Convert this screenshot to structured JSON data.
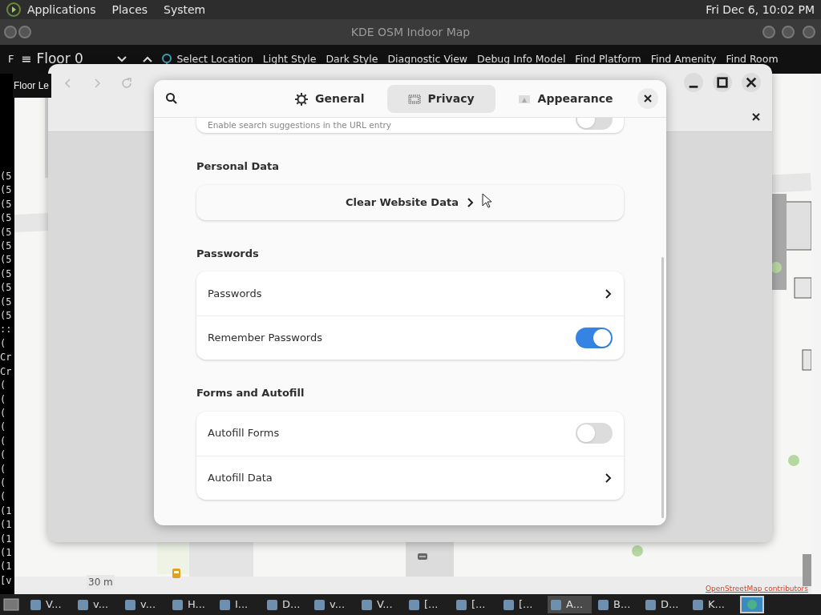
{
  "top_panel": {
    "menus": [
      "Applications",
      "Places",
      "System"
    ],
    "clock": "Fri Dec 6, 10:02 PM"
  },
  "map_window": {
    "title": "KDE OSM Indoor Map",
    "side_label": "F",
    "menu_glyph": "≡",
    "floor": "Floor 0",
    "actions": [
      "Select Location",
      "Light Style",
      "Dark Style",
      "Diagnostic View",
      "Debug Info Model",
      "Find Platform",
      "Find Amenity",
      "Find Room"
    ],
    "floor_label": "Floor Le",
    "scale": "30 m",
    "attribution": "OpenStreetMap contributors"
  },
  "terminal": {
    "lines": [
      "(5",
      "(5",
      "(5",
      "(5",
      "(5",
      "(5",
      "(5",
      "(5",
      "(5",
      "(5",
      "(5",
      "::",
      "(",
      "Cr",
      "Cr",
      "(",
      "(",
      "(",
      "(",
      "(",
      "(",
      "(",
      "(",
      "(",
      "(1",
      "(1",
      "(1",
      "(1",
      "(1",
      "[v"
    ]
  },
  "preferences": {
    "tabs": [
      {
        "label": "General",
        "selected": false
      },
      {
        "label": "Privacy",
        "selected": true
      },
      {
        "label": "Appearance",
        "selected": false
      }
    ],
    "sections": [
      {
        "rows": [
          {
            "kind": "toggle",
            "subtitle": "Enable search suggestions in the URL entry",
            "on": false
          }
        ]
      },
      {
        "title": "Personal Data",
        "rows": [
          {
            "kind": "button",
            "label": "Clear Website Data"
          }
        ]
      },
      {
        "title": "Passwords",
        "rows": [
          {
            "kind": "link",
            "label": "Passwords"
          },
          {
            "kind": "toggle",
            "label": "Remember Passwords",
            "on": true
          }
        ]
      },
      {
        "title": "Forms and Autofill",
        "rows": [
          {
            "kind": "toggle",
            "label": "Autofill Forms",
            "on": false
          },
          {
            "kind": "link",
            "label": "Autofill Data"
          }
        ]
      }
    ]
  },
  "taskbar": {
    "items": [
      {
        "label": "V...",
        "selected": false
      },
      {
        "label": "v...",
        "selected": false
      },
      {
        "label": "v...",
        "selected": false
      },
      {
        "label": "H...",
        "selected": false
      },
      {
        "label": "I...",
        "selected": false
      },
      {
        "label": "D...",
        "selected": false
      },
      {
        "label": "v...",
        "selected": false
      },
      {
        "label": "V...",
        "selected": false
      },
      {
        "label": "[...",
        "selected": false
      },
      {
        "label": "[...",
        "selected": false
      },
      {
        "label": "[...",
        "selected": false
      },
      {
        "label": "A...",
        "selected": true
      },
      {
        "label": "B...",
        "selected": false
      },
      {
        "label": "D...",
        "selected": false
      },
      {
        "label": "K...",
        "selected": false
      }
    ]
  }
}
